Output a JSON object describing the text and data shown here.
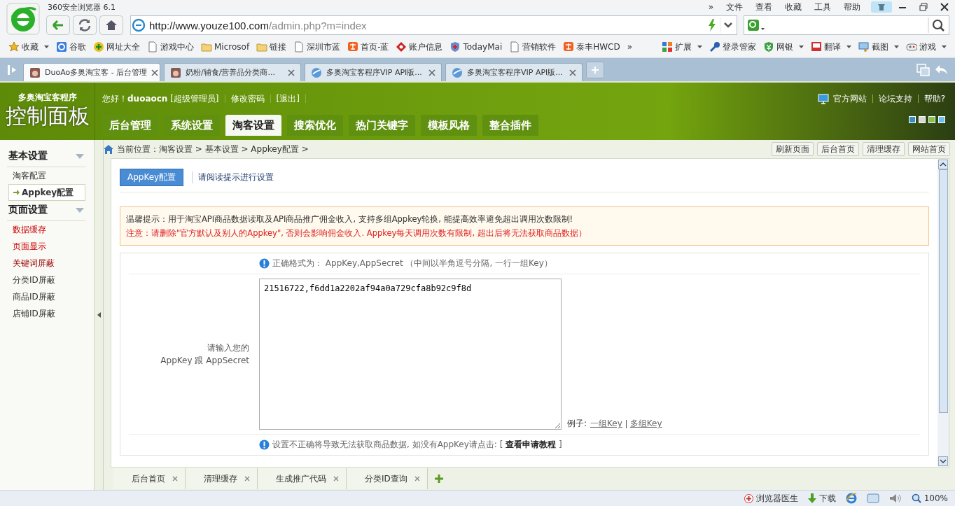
{
  "browser": {
    "title": "360安全浏览器 6.1",
    "menu": [
      "»",
      "文件",
      "查看",
      "收藏",
      "工具",
      "帮助"
    ],
    "address": {
      "host": "http://www.youze100.com",
      "path": "/admin.php?m=index"
    },
    "bookmarks": [
      {
        "label": "收藏",
        "kind": "star",
        "dropdown": true
      },
      {
        "label": "谷歌",
        "kind": "g",
        "dropdown": false
      },
      {
        "label": "网址大全",
        "kind": "plus",
        "dropdown": false
      },
      {
        "label": "游戏中心",
        "kind": "page",
        "dropdown": false
      },
      {
        "label": "Microsof",
        "kind": "folder",
        "dropdown": false
      },
      {
        "label": "链接",
        "kind": "folder",
        "dropdown": false
      },
      {
        "label": "深圳市蓝",
        "kind": "page",
        "dropdown": false
      },
      {
        "label": "首页-蓝",
        "kind": "tao",
        "dropdown": false
      },
      {
        "label": "账户信息",
        "kind": "diamond",
        "dropdown": false
      },
      {
        "label": "TodayMai",
        "kind": "shield",
        "dropdown": false
      },
      {
        "label": "营销软件",
        "kind": "page",
        "dropdown": false
      },
      {
        "label": "泰丰HWCD",
        "kind": "tao",
        "dropdown": false
      },
      {
        "label": "»",
        "kind": "more",
        "dropdown": false
      }
    ],
    "tools": [
      {
        "label": "扩展",
        "kind": "grid",
        "dropdown": true
      },
      {
        "label": "登录管家",
        "kind": "key",
        "dropdown": false
      },
      {
        "label": "网银",
        "kind": "coin",
        "dropdown": true
      },
      {
        "label": "翻译",
        "kind": "book",
        "dropdown": true
      },
      {
        "label": "截图",
        "kind": "screen",
        "dropdown": true
      },
      {
        "label": "游戏",
        "kind": "pad",
        "dropdown": true
      }
    ],
    "tabs": [
      {
        "label": "DuoAo多奥淘宝客 - 后台管理",
        "kind": "site",
        "selected": true
      },
      {
        "label": "奶粉/辅食/营养品分类商...",
        "kind": "site",
        "selected": false
      },
      {
        "label": "多奥淘宝客程序VIP API版...",
        "kind": "globe",
        "selected": false
      },
      {
        "label": "多奥淘宝客程序VIP API版...",
        "kind": "globe",
        "selected": false
      }
    ]
  },
  "app": {
    "brand": {
      "subtitle": "多奥淘宝客程序",
      "title": "控制面板"
    },
    "user": {
      "greeting": "您好！",
      "name": "duoaocn",
      "role": "[超级管理员]",
      "links": [
        "修改密码",
        "[退出]"
      ]
    },
    "top_links": [
      "官方网站",
      "论坛支持",
      "帮助?"
    ],
    "themes": [
      {
        "color": "#3a8fc8",
        "selected": false
      },
      {
        "color": "#d8d8d8",
        "selected": false
      },
      {
        "color": "#8cc63e",
        "selected": true
      },
      {
        "color": "#6ec0ec",
        "selected": false
      }
    ],
    "nav": [
      {
        "label": "后台管理",
        "selected": false
      },
      {
        "label": "系统设置",
        "selected": false
      },
      {
        "label": "淘客设置",
        "selected": true
      },
      {
        "label": "搜索优化",
        "selected": false
      },
      {
        "label": "热门关键字",
        "selected": false
      },
      {
        "label": "模板风格",
        "selected": false
      },
      {
        "label": "整合插件",
        "selected": false
      }
    ],
    "sidebar": [
      {
        "heading": "基本设置",
        "items": [
          {
            "label": "淘客配置",
            "kind": "normal",
            "selected": false
          },
          {
            "label": "Appkey配置",
            "kind": "normal",
            "selected": true
          }
        ]
      },
      {
        "heading": "页面设置",
        "items": [
          {
            "label": "数据缓存",
            "kind": "alert",
            "selected": false
          },
          {
            "label": "页面显示",
            "kind": "alert",
            "selected": false
          },
          {
            "label": "关键词屏蔽",
            "kind": "strong",
            "selected": false
          },
          {
            "label": "分类ID屏蔽",
            "kind": "normal",
            "selected": false
          },
          {
            "label": "商品ID屏蔽",
            "kind": "normal",
            "selected": false
          },
          {
            "label": "店铺ID屏蔽",
            "kind": "normal",
            "selected": false
          }
        ]
      }
    ],
    "breadcrumb": {
      "label": "当前位置：",
      "path": "淘客设置 > 基本设置 > Appkey配置 >"
    },
    "quick_buttons": [
      "刷新页面",
      "后台首页",
      "清理缓存",
      "网站首页"
    ],
    "page": {
      "tab": "AppKey配置",
      "tab_hint": "请阅读提示进行设置",
      "notice": [
        "温馨提示：用于淘宝API商品数据读取及API商品推广佣金收入, 支持多组Appkey轮换, 能提高效率避免超出调用次数限制!",
        "注意：请删除\"官方默认及别人的Appkey\", 否则会影响佣金收入. Appkey每天调用次数有限制, 超出后将无法获取商品数据）"
      ],
      "format_hint": "正确格式为： AppKey,AppSecret （中间以半角逗号分隔, 一行一组Key）",
      "field_label": [
        "请输入您的",
        "AppKey 跟 AppSecret"
      ],
      "field_value": "21516722,f6dd1a2202af94a0a729cfa8b92c9f8d",
      "example_label": "例子:",
      "example_links": [
        "一组Key",
        "多组Key"
      ],
      "help_text": "设置不正确将导致无法获取商品数据, 如没有AppKey请点击: [",
      "help_link": "查看申请教程",
      "help_end": "]"
    },
    "bottom_tabs": [
      "后台首页",
      "清理缓存",
      "生成推广代码",
      "分类ID查询"
    ]
  },
  "status_bar": {
    "doctor": "浏览器医生",
    "download": "下载",
    "zoom": "100%"
  }
}
